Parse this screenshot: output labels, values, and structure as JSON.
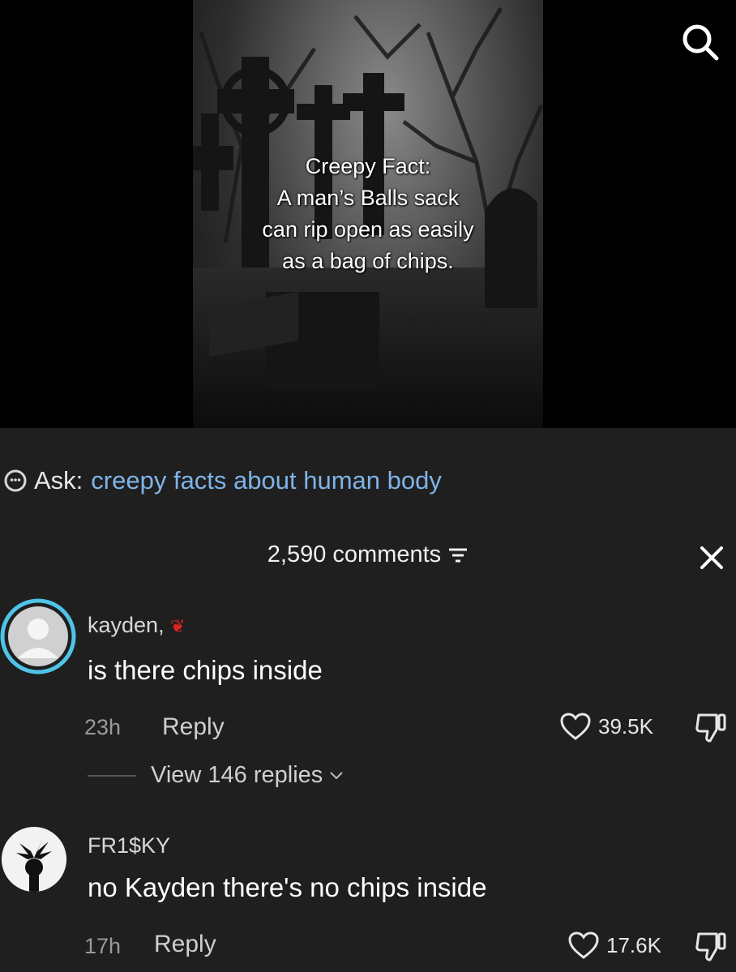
{
  "video": {
    "overlay_lines": [
      "Creepy Fact:",
      "A man’s Balls sack",
      "can rip open as easily",
      "as a bag of chips."
    ]
  },
  "icons": {
    "search": "search-icon",
    "ask": "ask-icon",
    "filter": "filter-icon",
    "close": "close-icon",
    "like": "heart-icon",
    "dislike": "thumbs-down-icon",
    "chevron": "chevron-down-icon"
  },
  "ask": {
    "label": "Ask:",
    "query": "creepy facts about human body"
  },
  "header": {
    "comments_count": "2,590 comments"
  },
  "comments": [
    {
      "username": "kayden,",
      "text": "is there chips inside",
      "time": "23h",
      "reply_label": "Reply",
      "likes": "39.5K",
      "view_replies": "View 146 replies"
    },
    {
      "username": "FR1$KY",
      "text": "no Kayden there's no chips inside",
      "time": "17h",
      "reply_label": "Reply",
      "likes": "17.6K"
    }
  ],
  "colors": {
    "sheet_bg": "#1f1f1f",
    "ask_query": "#7fb3e6",
    "avatar_ring": "#4fc3e8"
  }
}
